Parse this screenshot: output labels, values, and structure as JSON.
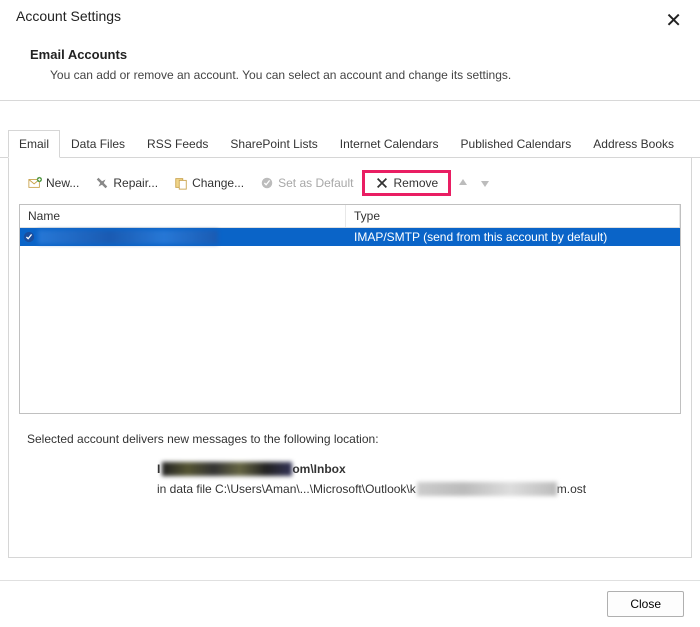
{
  "title": "Account Settings",
  "header": {
    "heading": "Email Accounts",
    "subtext": "You can add or remove an account. You can select an account and change its settings."
  },
  "tabs": [
    {
      "id": "email",
      "label": "Email",
      "active": true
    },
    {
      "id": "data-files",
      "label": "Data Files",
      "active": false
    },
    {
      "id": "rss-feeds",
      "label": "RSS Feeds",
      "active": false
    },
    {
      "id": "sharepoint-lists",
      "label": "SharePoint Lists",
      "active": false
    },
    {
      "id": "internet-calendars",
      "label": "Internet Calendars",
      "active": false
    },
    {
      "id": "published-calendars",
      "label": "Published Calendars",
      "active": false
    },
    {
      "id": "address-books",
      "label": "Address Books",
      "active": false
    }
  ],
  "toolbar": {
    "new": "New...",
    "repair": "Repair...",
    "change": "Change...",
    "set_default": "Set as Default",
    "remove": "Remove"
  },
  "list": {
    "col_name": "Name",
    "col_type": "Type",
    "rows": [
      {
        "type_text": "IMAP/SMTP (send from this account by default)"
      }
    ]
  },
  "footer": {
    "line1": "Selected account delivers new messages to the following location:",
    "mailbox_suffix": "om\\Inbox",
    "datafile_prefix": "in data file C:\\Users\\Aman\\...\\Microsoft\\Outlook\\k",
    "datafile_suffix": "m.ost"
  },
  "buttons": {
    "close": "Close"
  }
}
